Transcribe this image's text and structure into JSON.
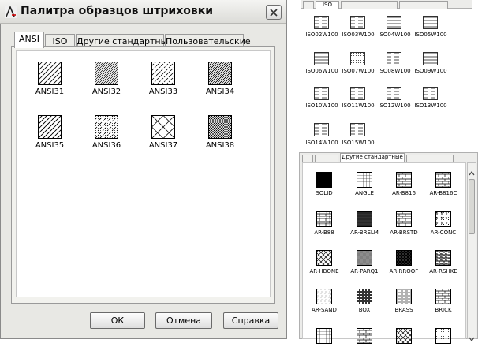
{
  "dialog": {
    "title": "Палитра образцов штриховки",
    "tabs": [
      "ANSI",
      "ISO",
      "Другие стандартные",
      "Пользовательские"
    ],
    "active_tab": "ANSI",
    "patterns": [
      "ANSI31",
      "ANSI32",
      "ANSI33",
      "ANSI34",
      "ANSI35",
      "ANSI36",
      "ANSI37",
      "ANSI38"
    ],
    "buttons": {
      "ok": "ОК",
      "cancel": "Отмена",
      "help": "Справка"
    }
  },
  "iso_panel": {
    "tab_label": "ISO",
    "patterns": [
      "ISO02W100",
      "ISO03W100",
      "ISO04W100",
      "ISO05W100",
      "ISO06W100",
      "ISO07W100",
      "ISO08W100",
      "ISO09W100",
      "ISO10W100",
      "ISO11W100",
      "ISO12W100",
      "ISO13W100",
      "ISO14W100",
      "ISO15W100"
    ]
  },
  "other_panel": {
    "tab_label": "Другие стандартные",
    "patterns": [
      "SOLID",
      "ANGLE",
      "AR-B816",
      "AR-B816C",
      "AR-B88",
      "AR-BRELM",
      "AR-BRSTD",
      "AR-CONC",
      "AR-HBONE",
      "AR-PARQ1",
      "AR-RROOF",
      "AR-RSHKE",
      "AR-SAND",
      "BOX",
      "BRASS",
      "BRICK"
    ]
  },
  "colors": {
    "dialog_bg": "#e8e8e4",
    "panel_bg": "#ffffff",
    "border": "#9a9a9a"
  }
}
